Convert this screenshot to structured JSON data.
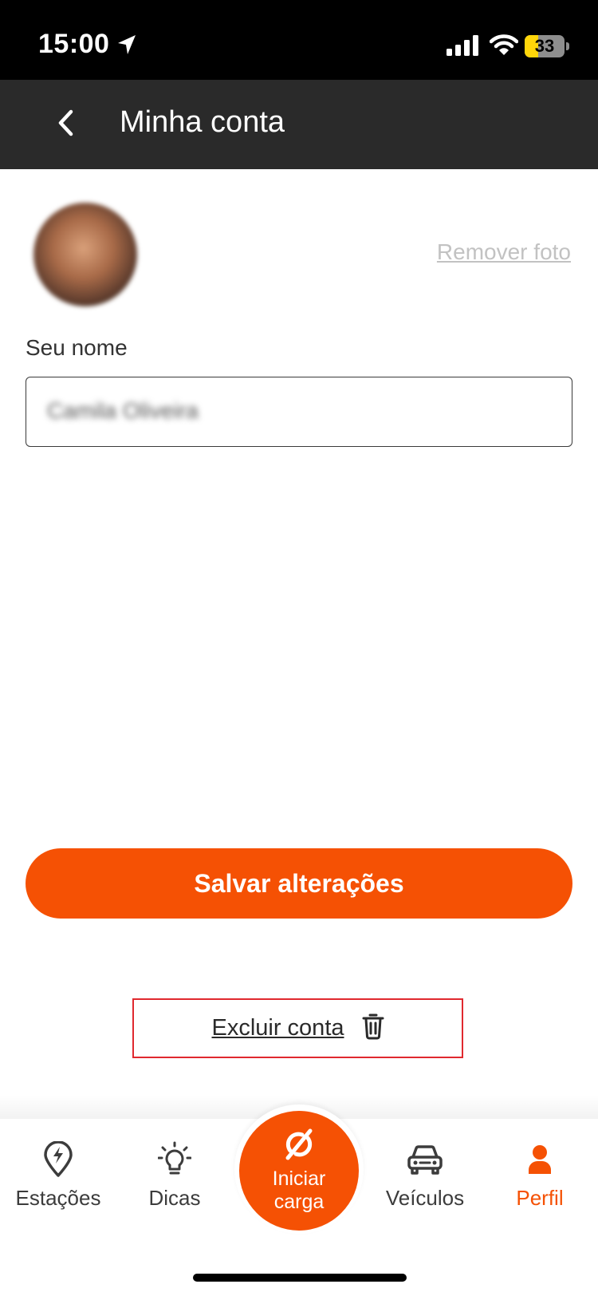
{
  "status_bar": {
    "time": "15:00",
    "battery": "33",
    "battery_level": 0.33,
    "icons": [
      "location-arrow-icon",
      "cellular-signal-icon",
      "wifi-icon",
      "battery-icon"
    ]
  },
  "header": {
    "back_icon": "chevron-left-icon",
    "title": "Minha conta"
  },
  "profile": {
    "remove_photo_label": "Remover foto",
    "name_label": "Seu nome",
    "name_value": "Camila Oliveira"
  },
  "actions": {
    "save_label": "Salvar alterações",
    "delete_label": "Excluir conta",
    "delete_icon": "trash-icon"
  },
  "tab_bar": {
    "items": [
      {
        "label": "Estações",
        "icon": "map-pin-bolt-icon",
        "active": false
      },
      {
        "label": "Dicas",
        "icon": "lightbulb-icon",
        "active": false
      },
      {
        "label": "Iniciar carga",
        "icon": "charge-slash-icon",
        "active": false
      },
      {
        "label": "Veículos",
        "icon": "car-icon",
        "active": false
      },
      {
        "label": "Perfil",
        "icon": "person-icon",
        "active": true
      }
    ]
  },
  "colors": {
    "accent": "#f55104",
    "header_bg": "#2a2a2a",
    "delete_border": "#e0292f",
    "inactive_text": "#3c3c3c",
    "muted_link": "#c2c2c2"
  }
}
